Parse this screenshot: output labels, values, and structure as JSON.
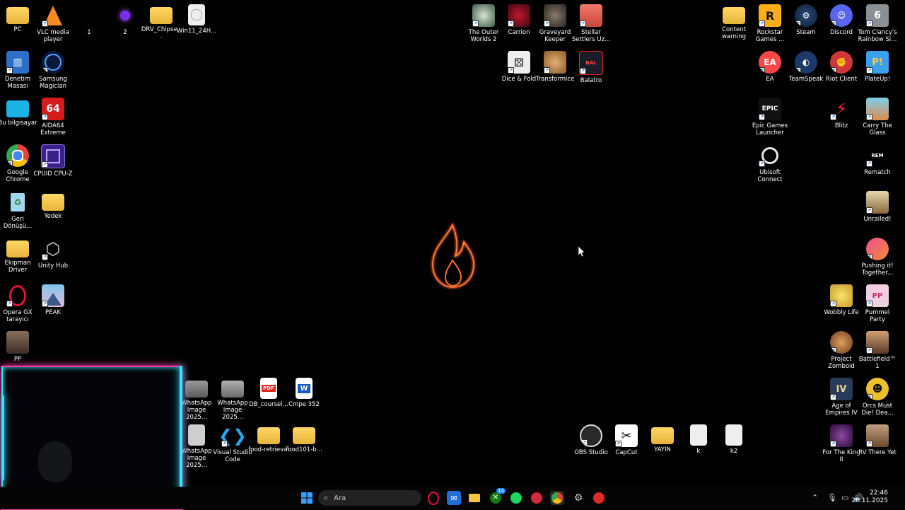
{
  "desktop": {
    "left_col1": [
      {
        "label": "PC",
        "icon": "folder-icon"
      },
      {
        "label": "Denetim Masası",
        "icon": "control-panel-icon"
      },
      {
        "label": "Bu bilgisayar",
        "icon": "monitor-icon"
      },
      {
        "label": "Google Chrome",
        "icon": "chrome-icon"
      },
      {
        "label": "Geri Dönüşü...",
        "icon": "recycle-bin-icon"
      },
      {
        "label": "Ekipman Driver",
        "icon": "folder-icon"
      },
      {
        "label": "Opera GX tarayıcı",
        "icon": "opera-gx-icon"
      },
      {
        "label": "PP",
        "icon": "photo-icon"
      }
    ],
    "left_col2": [
      {
        "label": "VLC media player",
        "icon": "vlc-icon"
      },
      {
        "label": "Samsung Magician",
        "icon": "samsung-magician-icon"
      },
      {
        "label": "AIDA64 Extreme",
        "icon": "aida64-icon"
      },
      {
        "label": "CPUID CPU-Z",
        "icon": "cpuz-icon"
      },
      {
        "label": "Yedek",
        "icon": "folder-icon"
      },
      {
        "label": "Unity Hub",
        "icon": "unity-icon"
      },
      {
        "label": "PEAK",
        "icon": "peak-icon"
      }
    ],
    "top_row": [
      {
        "label": "1",
        "icon": "blank-icon"
      },
      {
        "label": "2",
        "icon": "purple-app-icon"
      },
      {
        "label": "DRV_Chipse...",
        "icon": "folder-icon"
      },
      {
        "label": "Win11_24H...",
        "icon": "disc-image-icon"
      }
    ],
    "games_top": [
      {
        "label": "The Outer Worlds 2"
      },
      {
        "label": "Carrion"
      },
      {
        "label": "Graveyard Keeper"
      },
      {
        "label": "Stellar Settlers Uz..."
      },
      {
        "label": "Dice & Fold"
      },
      {
        "label": "Transformice"
      },
      {
        "label": "Balatro"
      }
    ],
    "right_col_a": [
      {
        "label": "Content warning"
      },
      {
        "label": "Rockstar Games ..."
      },
      {
        "label": "EA"
      },
      {
        "label": "Epic Games Launcher"
      },
      {
        "label": "Ubisoft Connect"
      }
    ],
    "right_col_b": [
      {
        "label": "Steam"
      },
      {
        "label": "TeamSpeak"
      }
    ],
    "right_col_c": [
      {
        "label": "Discord"
      },
      {
        "label": "Riot Client"
      },
      {
        "label": "Blitz"
      },
      {
        "label": "Wobbly Life"
      },
      {
        "label": "Project Zomboid"
      },
      {
        "label": "Age of Empires IV"
      },
      {
        "label": "For The King II"
      }
    ],
    "right_col_d": [
      {
        "label": "Tom Clancy's Rainbow Si..."
      },
      {
        "label": "PlateUp!"
      },
      {
        "label": "Carry The Glass"
      },
      {
        "label": "Rematch"
      },
      {
        "label": "Unrailed!"
      },
      {
        "label": "Pushing it! Together..."
      },
      {
        "label": "Pummel Party"
      },
      {
        "label": "Battlefield™ 1"
      },
      {
        "label": "Orcs Must Die! Dea..."
      },
      {
        "label": "RV There Yet"
      }
    ],
    "bottom_mid_row1": [
      {
        "label": "WhatsApp Image 2025..."
      },
      {
        "label": "WhatsApp Image 2025..."
      },
      {
        "label": "DB_coursel..."
      },
      {
        "label": "Cmpe 352"
      }
    ],
    "bottom_mid_row2": [
      {
        "label": "WhatsApp Image 2025..."
      },
      {
        "label": "Visual Studio Code"
      },
      {
        "label": "food-retrieval"
      },
      {
        "label": "food101-b..."
      }
    ],
    "bottom_right_row": [
      {
        "label": "OBS Studio"
      },
      {
        "label": "CapCut"
      },
      {
        "label": "YAYIN"
      },
      {
        "label": "k"
      },
      {
        "label": "k2"
      }
    ]
  },
  "taskbar": {
    "search_placeholder": "Ara",
    "xbox_badge": "14",
    "time": "22:46",
    "date": "20.11.2025"
  }
}
